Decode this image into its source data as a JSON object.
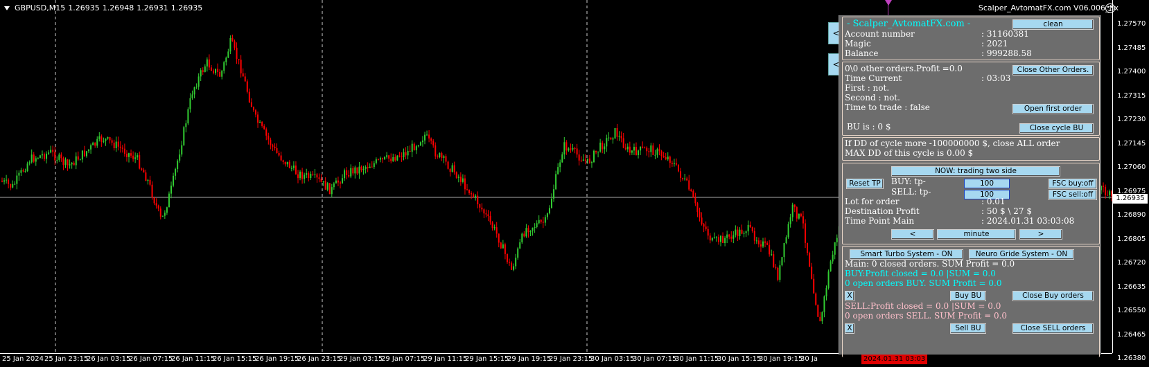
{
  "chart": {
    "symbol": "GBPUSD,M15",
    "ohlc": [
      "1.26935",
      "1.26948",
      "1.26931",
      "1.26935"
    ],
    "ea_name": "Scalper_AvtomatFX.com V06.006_fix",
    "current_price": "1.26935",
    "current_time": "2024.01.31 03:03",
    "price_ticks": [
      "1.27570",
      "1.27485",
      "1.27400",
      "1.27315",
      "1.27230",
      "1.27145",
      "1.27060",
      "1.26975",
      "1.26890",
      "1.26805",
      "1.26720",
      "1.26635",
      "1.26550",
      "1.26465",
      "1.26380"
    ],
    "time_ticks": [
      "25 Jan 2024",
      "25 Jan 23:15",
      "26 Jan 03:15",
      "26 Jan 07:15",
      "26 Jan 11:15",
      "26 Jan 15:15",
      "26 Jan 19:15",
      "26 Jan 23:15",
      "29 Jan 03:15",
      "29 Jan 07:15",
      "29 Jan 11:15",
      "29 Jan 15:15",
      "29 Jan 19:15",
      "29 Jan 23:15",
      "30 Jan 03:15",
      "30 Jan 07:15",
      "30 Jan 11:15",
      "30 Jan 15:15",
      "30 Jan 19:15",
      "30 Ja"
    ],
    "colors": {
      "bull": "#32cd32",
      "bear": "#ff0000",
      "background": "#000000",
      "marker": "#c040c0"
    }
  },
  "side_buttons": [
    "<",
    "<"
  ],
  "panel": {
    "title": "- Scalper_AvtomatFX.com -",
    "clean_label": "clean",
    "account_label": "Account number",
    "account_value": ": 31160381",
    "magic_label": "Magic",
    "magic_value": ": 2021",
    "balance_label": "Balance",
    "balance_value": ": 999288.58",
    "other_orders": "0\\0 other orders.Profit =0.0",
    "close_other_label": "Close Other Orders.",
    "time_current_label": "Time Current",
    "time_current_value": ": 03:03",
    "first_text": "First      : not.",
    "second_text": "Second   : not.",
    "time_to_trade": "Time to trade :  false",
    "open_first_label": "Open first order",
    "bu_text": "BU is :   0 $",
    "close_cycle_label": "Close cycle BU",
    "dd_line1": "If DD of cycle more -100000000 $, close ALL order",
    "dd_line2": "MAX DD of this cycle is 0.00 $",
    "now_trading_label": "NOW: trading two side",
    "reset_tp_label": "Reset TP",
    "buy_tp_label": "BUY:     tp-",
    "sell_tp_label": "SELL:    tp-",
    "buy_tp_value": "100",
    "sell_tp_value": "100",
    "fsc_buy_label": "FSC buy:off",
    "fsc_sell_label": "FSC sell:off",
    "lot_label": "Lot for order",
    "lot_value": ": 0.01",
    "dest_label": "Destination Profit",
    "dest_value": ": 50 $ \\ 27 $",
    "tpm_label": "Time Point Main",
    "tpm_value": ": 2024.01.31 03:03:08",
    "prev_label": "<",
    "minute_label": "minute",
    "next_label": ">",
    "smart_turbo_label": "Smart Turbo System - ON",
    "neuro_label": "Neuro Gride System - ON",
    "main_text": "Main: 0 closed orders. SUM Profit = 0.0",
    "buy_profit": "BUY:Profit closed = 0.0  |SUM = 0.0",
    "buy_open": "0 open orders BUY. SUM Profit = 0.0",
    "x_label": "X",
    "buy_bu_label": "Buy BU",
    "close_buy_label": "Close Buy orders",
    "sell_profit": "SELL:Profit closed = 0.0  |SUM = 0.0",
    "sell_open": "0 open orders SELL. SUM Profit = 0.0",
    "x2_label": "X",
    "sell_bu_label": "Sell BU",
    "close_sell_label": "Close SELL orders"
  }
}
